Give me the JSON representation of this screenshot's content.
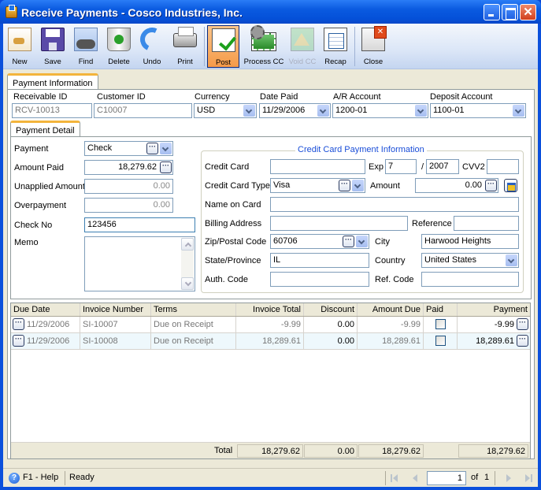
{
  "window": {
    "title": "Receive Payments - Cosco Industries, Inc."
  },
  "toolbar": {
    "buttons": [
      {
        "label": "New",
        "icon": "new-icon"
      },
      {
        "label": "Save",
        "icon": "save-icon"
      },
      {
        "label": "Find",
        "icon": "find-icon"
      },
      {
        "label": "Delete",
        "icon": "delete-icon"
      },
      {
        "label": "Undo",
        "icon": "undo-icon"
      },
      {
        "label": "Print",
        "icon": "print-icon"
      },
      {
        "label": "Post",
        "icon": "post-icon",
        "state": "active"
      },
      {
        "label": "Process CC",
        "icon": "process-cc-icon"
      },
      {
        "label": "Void CC",
        "icon": "void-cc-icon",
        "state": "disabled"
      },
      {
        "label": "Recap",
        "icon": "recap-icon"
      },
      {
        "label": "Close",
        "icon": "close-icon"
      }
    ]
  },
  "tabs": {
    "payment_information": "Payment Information",
    "payment_detail": "Payment Detail"
  },
  "header_fields": {
    "receivable_id": {
      "label": "Receivable ID",
      "value": "RCV-10013"
    },
    "customer_id": {
      "label": "Customer ID",
      "value": "C10007"
    },
    "currency": {
      "label": "Currency",
      "value": "USD"
    },
    "date_paid": {
      "label": "Date Paid",
      "value": "11/29/2006"
    },
    "ar_account": {
      "label": "A/R Account",
      "value": "1200-01"
    },
    "deposit_account": {
      "label": "Deposit Account",
      "value": "1100-01"
    }
  },
  "payment_detail": {
    "payment": {
      "label": "Payment",
      "value": "Check"
    },
    "amount_paid": {
      "label": "Amount Paid",
      "value": "18,279.62"
    },
    "unapplied_amount": {
      "label": "Unapplied Amount",
      "value": "0.00"
    },
    "overpayment": {
      "label": "Overpayment",
      "value": "0.00"
    },
    "check_no": {
      "label": "Check No",
      "value": "123456"
    },
    "memo": {
      "label": "Memo",
      "value": ""
    }
  },
  "credit_card": {
    "title": "Credit Card Payment Information",
    "credit_card": {
      "label": "Credit Card",
      "value": ""
    },
    "exp": {
      "label": "Exp",
      "month": "7",
      "sep": "/",
      "year": "2007"
    },
    "cvv2": {
      "label": "CVV2",
      "value": ""
    },
    "card_type": {
      "label": "Credit Card Type",
      "value": "Visa"
    },
    "amount": {
      "label": "Amount",
      "value": "0.00"
    },
    "name_on_card": {
      "label": "Name on Card",
      "value": ""
    },
    "billing_address": {
      "label": "Billing Address",
      "value": ""
    },
    "reference": {
      "label": "Reference",
      "value": ""
    },
    "zip": {
      "label": "Zip/Postal Code",
      "value": "60706"
    },
    "city": {
      "label": "City",
      "value": "Harwood Heights"
    },
    "state": {
      "label": "State/Province",
      "value": "IL"
    },
    "country": {
      "label": "Country",
      "value": "United States"
    },
    "auth_code": {
      "label": "Auth. Code",
      "value": ""
    },
    "ref_code": {
      "label": "Ref. Code",
      "value": ""
    }
  },
  "grid": {
    "columns": [
      "Due Date",
      "Invoice Number",
      "Terms",
      "Invoice Total",
      "Discount",
      "Amount Due",
      "Paid",
      "Payment"
    ],
    "rows": [
      {
        "due_date": "11/29/2006",
        "invoice": "SI-10007",
        "terms": "Due on Receipt",
        "invoice_total": "-9.99",
        "discount": "0.00",
        "amount_due": "-9.99",
        "paid": false,
        "payment": "-9.99"
      },
      {
        "due_date": "11/29/2006",
        "invoice": "SI-10008",
        "terms": "Due on Receipt",
        "invoice_total": "18,289.61",
        "discount": "0.00",
        "amount_due": "18,289.61",
        "paid": false,
        "payment": "18,289.61"
      }
    ],
    "totals": {
      "label": "Total",
      "invoice_total": "18,279.62",
      "discount": "0.00",
      "amount_due": "18,279.62",
      "payment": "18,279.62"
    }
  },
  "statusbar": {
    "help": "F1 - Help",
    "status": "Ready",
    "page": "1",
    "of_label": "of",
    "total_pages": "1"
  },
  "ellipsis": "···"
}
